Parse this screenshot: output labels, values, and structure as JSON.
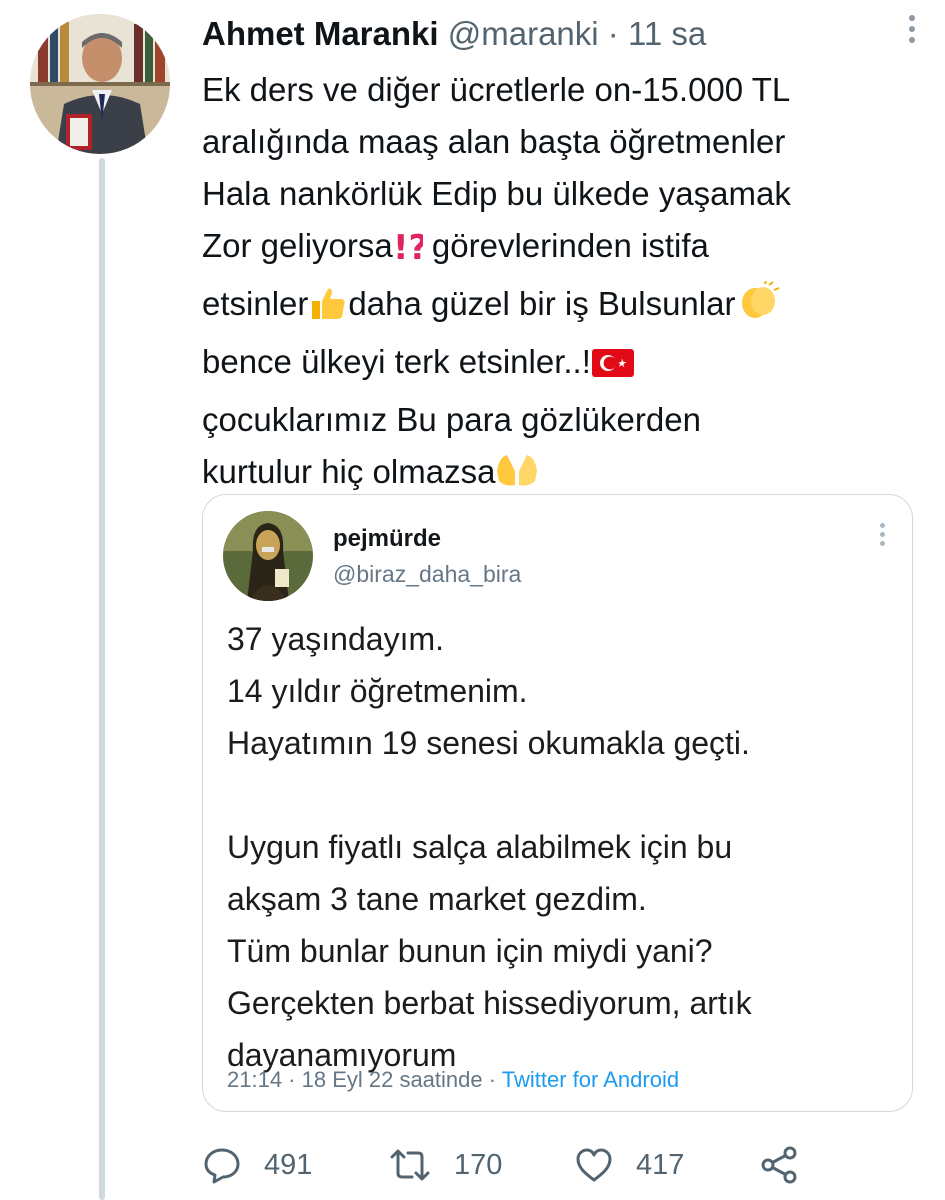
{
  "tweet": {
    "author_name": "Ahmet Maranki",
    "author_handle": "@maranki",
    "separator": "·",
    "time": "11 sa",
    "text_lines": [
      "Ek ders ve diğer ücretlerle on-15.000 TL",
      "aralığında maaş alan başta öğretmenler",
      "Hala nankörlük Edip bu ülkede yaşamak",
      "Zor geliyorsa",
      "görevlerinden istifa",
      "etsinler",
      "daha güzel bir iş Bulsunlar",
      "bence ülkeyi terk etsinler..!",
      "çocuklarımız Bu para gözlükerden",
      "kurtulur hiç olmazsa"
    ],
    "emojis": {
      "interrobang": "⁉",
      "thumbs_up": "👍",
      "clapping": "👏",
      "flag": "turkey-flag-icon",
      "palms": "🤲"
    }
  },
  "quoted": {
    "name": "pejmürde",
    "handle": "@biraz_daha_bira",
    "lines": [
      "37 yaşındayım.",
      "14 yıldır öğretmenim.",
      "Hayatımın 19 senesi okumakla geçti.",
      "Uygun fiyatlı salça alabilmek için bu",
      "akşam 3 tane market gezdim.",
      "Tüm bunlar bunun için miydi yani?",
      "Gerçekten berbat hissediyorum, artık",
      "dayanamıyorum"
    ],
    "meta_time": "21:14 · 18 Eyl 22 saatinde ·",
    "meta_client": "Twitter for Android"
  },
  "actions": {
    "replies": "491",
    "retweets": "170",
    "likes": "417"
  },
  "colors": {
    "text": "#0f1419",
    "secondary": "#536471",
    "accent": "#1d9bf0",
    "border": "#cfd9de"
  }
}
